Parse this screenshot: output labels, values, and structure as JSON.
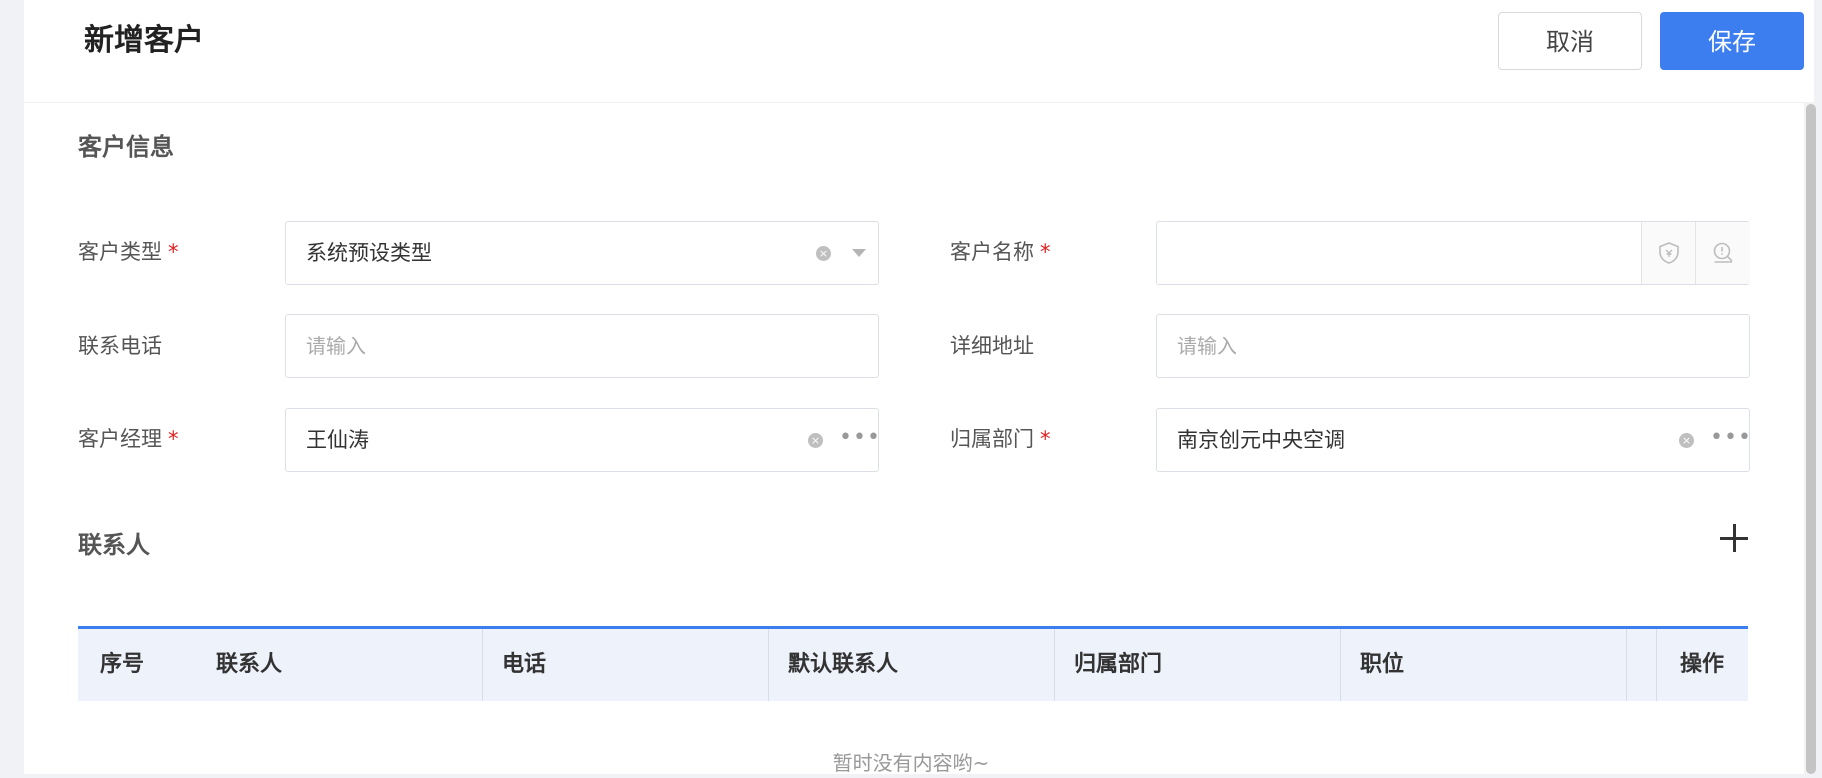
{
  "header": {
    "title": "新增客户",
    "cancel_label": "取消",
    "save_label": "保存"
  },
  "customer_info": {
    "section_title": "客户信息",
    "fields": {
      "customer_type": {
        "label": "客户类型",
        "required": "*",
        "value": "系统预设类型"
      },
      "customer_name": {
        "label": "客户名称",
        "required": "*",
        "value": ""
      },
      "phone": {
        "label": "联系电话",
        "placeholder": "请输入"
      },
      "address": {
        "label": "详细地址",
        "placeholder": "请输入"
      },
      "manager": {
        "label": "客户经理",
        "required": "*",
        "value": "王仙涛"
      },
      "department": {
        "label": "归属部门",
        "required": "*",
        "value": "南京创元中央空调"
      }
    }
  },
  "contacts": {
    "section_title": "联系人",
    "columns": [
      "序号",
      "联系人",
      "电话",
      "默认联系人",
      "归属部门",
      "职位",
      "操作"
    ],
    "empty_text": "暂时没有内容哟~"
  },
  "colors": {
    "accent": "#3c7ef0",
    "required": "#e02020"
  },
  "icons": {
    "clear": "clear-circle-icon",
    "dropdown": "chevron-down-icon",
    "more": "ellipsis-icon",
    "shield": "shield-icon",
    "search": "search-alert-icon",
    "add": "plus-icon"
  }
}
